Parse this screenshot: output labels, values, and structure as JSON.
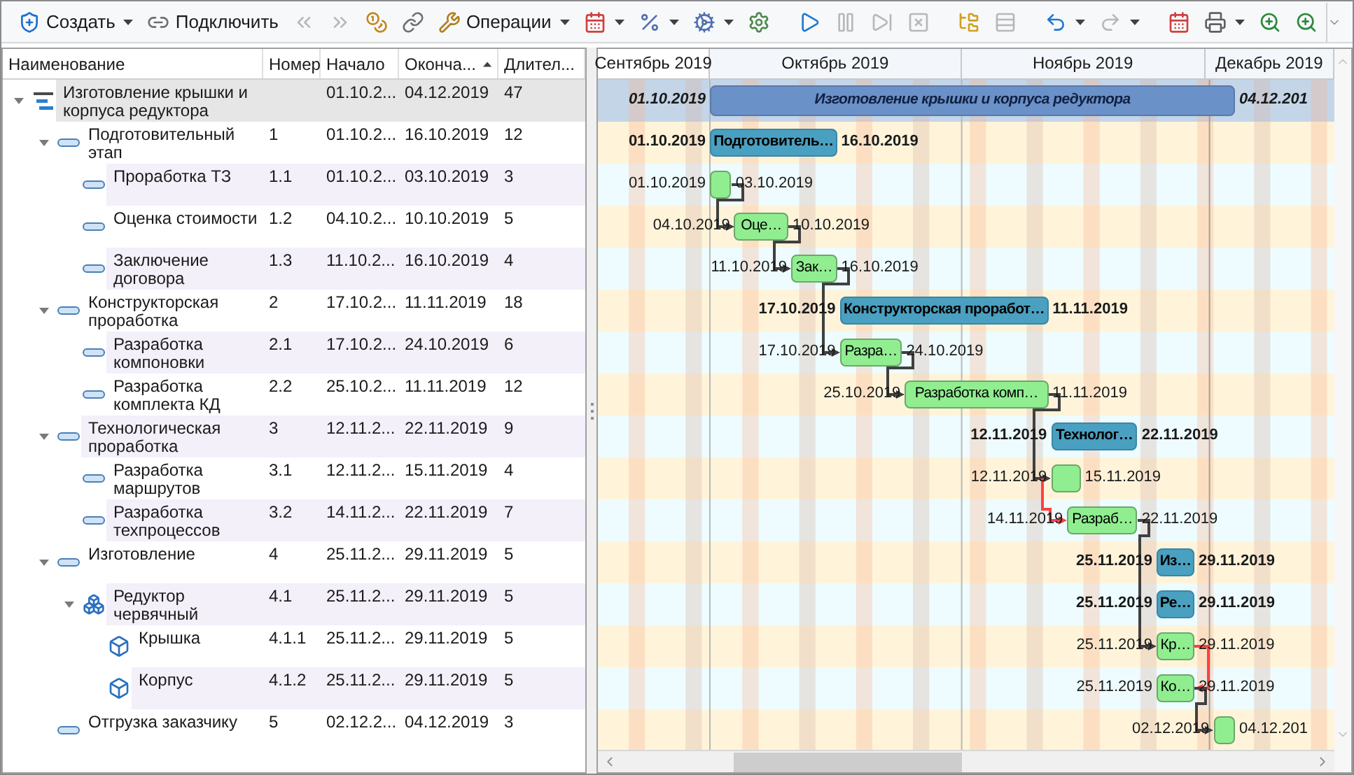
{
  "toolbar": [
    {
      "kind": "button",
      "label": "Создать",
      "disabled": false,
      "dropdown": true
    },
    {
      "kind": "button",
      "label": "Подключить",
      "disabled": false,
      "dropdown": false
    },
    {
      "kind": "button",
      "disabled": true,
      "dropdown": false
    },
    {
      "kind": "button",
      "disabled": true,
      "dropdown": false
    },
    {
      "kind": "button",
      "disabled": false,
      "dropdown": false
    },
    {
      "kind": "button",
      "disabled": false,
      "dropdown": false
    },
    {
      "kind": "button",
      "label": "Операции",
      "disabled": false,
      "dropdown": true
    },
    {
      "kind": "button",
      "disabled": false,
      "dropdown": true
    },
    {
      "kind": "button",
      "disabled": false,
      "dropdown": true
    },
    {
      "kind": "button",
      "disabled": false,
      "dropdown": true
    },
    {
      "kind": "button",
      "disabled": false,
      "dropdown": false
    },
    {
      "kind": "separator"
    },
    {
      "kind": "button",
      "disabled": false,
      "dropdown": false
    },
    {
      "kind": "button",
      "disabled": true,
      "dropdown": false
    },
    {
      "kind": "button",
      "disabled": true,
      "dropdown": false
    },
    {
      "kind": "button",
      "disabled": true,
      "dropdown": false
    },
    {
      "kind": "separator"
    },
    {
      "kind": "button",
      "disabled": false,
      "dropdown": false
    },
    {
      "kind": "button",
      "disabled": true,
      "dropdown": false
    },
    {
      "kind": "separator"
    },
    {
      "kind": "button",
      "disabled": false,
      "dropdown": true
    },
    {
      "kind": "button",
      "disabled": true,
      "dropdown": true
    },
    {
      "kind": "separator"
    },
    {
      "kind": "button",
      "disabled": false,
      "dropdown": false
    },
    {
      "kind": "button",
      "disabled": false,
      "dropdown": true
    },
    {
      "kind": "button",
      "disabled": false,
      "dropdown": false
    },
    {
      "kind": "button",
      "disabled": false,
      "dropdown": false
    }
  ],
  "table": {
    "columns": [
      {
        "label": "Наименование"
      },
      {
        "label": "Номер"
      },
      {
        "label": "Начало"
      },
      {
        "label": "Оконча...",
        "sorted": true
      },
      {
        "label": "Длител..."
      }
    ]
  },
  "tree": [
    {
      "kind": "root",
      "name": "Изготовление крышки и корпуса редуктора",
      "start": "01.10.2...",
      "end": "04.12.2019",
      "duration": "47",
      "selected": true,
      "expanded": true,
      "bar": {
        "start": "01.10.2019",
        "label": "Изготовление крышки и корпуса редуктора",
        "end": "04.12.201"
      },
      "children": [
        {
          "kind": "summary",
          "name": "Подготовительный этап",
          "number": "1",
          "start": "01.10.2...",
          "end": "16.10.2019",
          "duration": "12",
          "selected": false,
          "expanded": true,
          "bar": {
            "start": "01.10.2019",
            "label": "Подготовитель…",
            "end": "16.10.2019"
          },
          "children": [
            {
              "kind": "task",
              "name": "Проработка ТЗ",
              "number": "1.1",
              "start": "01.10.2...",
              "end": "03.10.2019",
              "duration": "3",
              "selected": false,
              "bar": {
                "start": "01.10.2019",
                "end": "03.10.2019"
              }
            },
            {
              "kind": "task",
              "name": "Оценка стоимости",
              "number": "1.2",
              "start": "04.10.2...",
              "end": "10.10.2019",
              "duration": "5",
              "selected": false,
              "bar": {
                "start": "04.10.2019",
                "label": "Оце…",
                "end": "10.10.2019"
              }
            },
            {
              "kind": "task",
              "name": "Заключение договора",
              "number": "1.3",
              "start": "11.10.2...",
              "end": "16.10.2019",
              "duration": "4",
              "selected": false,
              "bar": {
                "start": "11.10.2019",
                "label": "Зак…",
                "end": "16.10.2019"
              }
            }
          ]
        },
        {
          "kind": "summary",
          "name": "Конструкторская проработка",
          "number": "2",
          "start": "17.10.2...",
          "end": "11.11.2019",
          "duration": "18",
          "selected": false,
          "expanded": true,
          "bar": {
            "start": "17.10.2019",
            "label": "Конструкторская проработ…",
            "end": "11.11.2019"
          },
          "children": [
            {
              "kind": "task",
              "name": "Разработка компоновки",
              "number": "2.1",
              "start": "17.10.2...",
              "end": "24.10.2019",
              "duration": "6",
              "selected": false,
              "bar": {
                "start": "17.10.2019",
                "label": "Разра…",
                "end": "24.10.2019"
              }
            },
            {
              "kind": "task",
              "name": "Разработка комплекта КД",
              "number": "2.2",
              "start": "25.10.2...",
              "end": "11.11.2019",
              "duration": "12",
              "selected": false,
              "bar": {
                "start": "25.10.2019",
                "label": "Разработка комп…",
                "end": "11.11.2019"
              }
            }
          ]
        },
        {
          "kind": "summary",
          "name": "Технологическая проработка",
          "number": "3",
          "start": "12.11.2...",
          "end": "22.11.2019",
          "duration": "9",
          "selected": false,
          "expanded": true,
          "bar": {
            "start": "12.11.2019",
            "label": "Технолог…",
            "end": "22.11.2019"
          },
          "children": [
            {
              "kind": "task",
              "name": "Разработка маршрутов",
              "number": "3.1",
              "start": "12.11.2...",
              "end": "15.11.2019",
              "duration": "4",
              "selected": false,
              "bar": {
                "start": "12.11.2019",
                "end": "15.11.2019"
              }
            },
            {
              "kind": "task",
              "name": "Разработка техпроцессов",
              "number": "3.2",
              "start": "14.11.2...",
              "end": "22.11.2019",
              "duration": "7",
              "selected": false,
              "bar": {
                "start": "14.11.2019",
                "label": "Разраб…",
                "end": "22.11.2019"
              }
            }
          ]
        },
        {
          "kind": "summary",
          "name": "Изготовление",
          "number": "4",
          "start": "25.11.2...",
          "end": "29.11.2019",
          "duration": "5",
          "selected": false,
          "expanded": true,
          "bar": {
            "start": "25.11.2019",
            "label": "Из…",
            "end": "29.11.2019"
          },
          "children": [
            {
              "kind": "assembly",
              "name": "Редуктор червячный",
              "number": "4.1",
              "start": "25.11.2...",
              "end": "29.11.2019",
              "duration": "5",
              "selected": false,
              "expanded": true,
              "bar": {
                "start": "25.11.2019",
                "label": "Ре…",
                "end": "29.11.2019"
              },
              "children": [
                {
                  "kind": "part",
                  "name": "Крышка",
                  "number": "4.1.1",
                  "start": "25.11.2...",
                  "end": "29.11.2019",
                  "duration": "5",
                  "selected": false,
                  "bar": {
                    "start": "25.11.2019",
                    "label": "Кр…",
                    "end": "29.11.2019"
                  }
                },
                {
                  "kind": "part",
                  "name": "Корпус",
                  "number": "4.1.2",
                  "start": "25.11.2...",
                  "end": "29.11.2019",
                  "duration": "5",
                  "selected": false,
                  "bar": {
                    "start": "25.11.2019",
                    "label": "Ко…",
                    "end": "29.11.2019"
                  }
                }
              ]
            }
          ]
        },
        {
          "kind": "task",
          "name": "Отгрузка заказчику",
          "number": "5",
          "start": "02.12.2...",
          "end": "04.12.2019",
          "duration": "3",
          "selected": false,
          "bar": {
            "start": "02.12.2019",
            "end": "04.12.201"
          }
        }
      ]
    }
  ],
  "timeline": {
    "months": [
      "Сентябрь 2019",
      "Октябрь 2019",
      "Ноябрь 2019",
      "Декабрь 2019"
    ]
  },
  "links": [
    {
      "color": "#404040"
    },
    {
      "color": "#404040"
    },
    {
      "color": "#404040"
    },
    {
      "color": "#404040"
    },
    {
      "color": "#404040"
    },
    {
      "color": "#ff4040"
    },
    {
      "color": "#404040"
    },
    {
      "color": "#ff4040"
    },
    {
      "color": "#404040"
    }
  ]
}
